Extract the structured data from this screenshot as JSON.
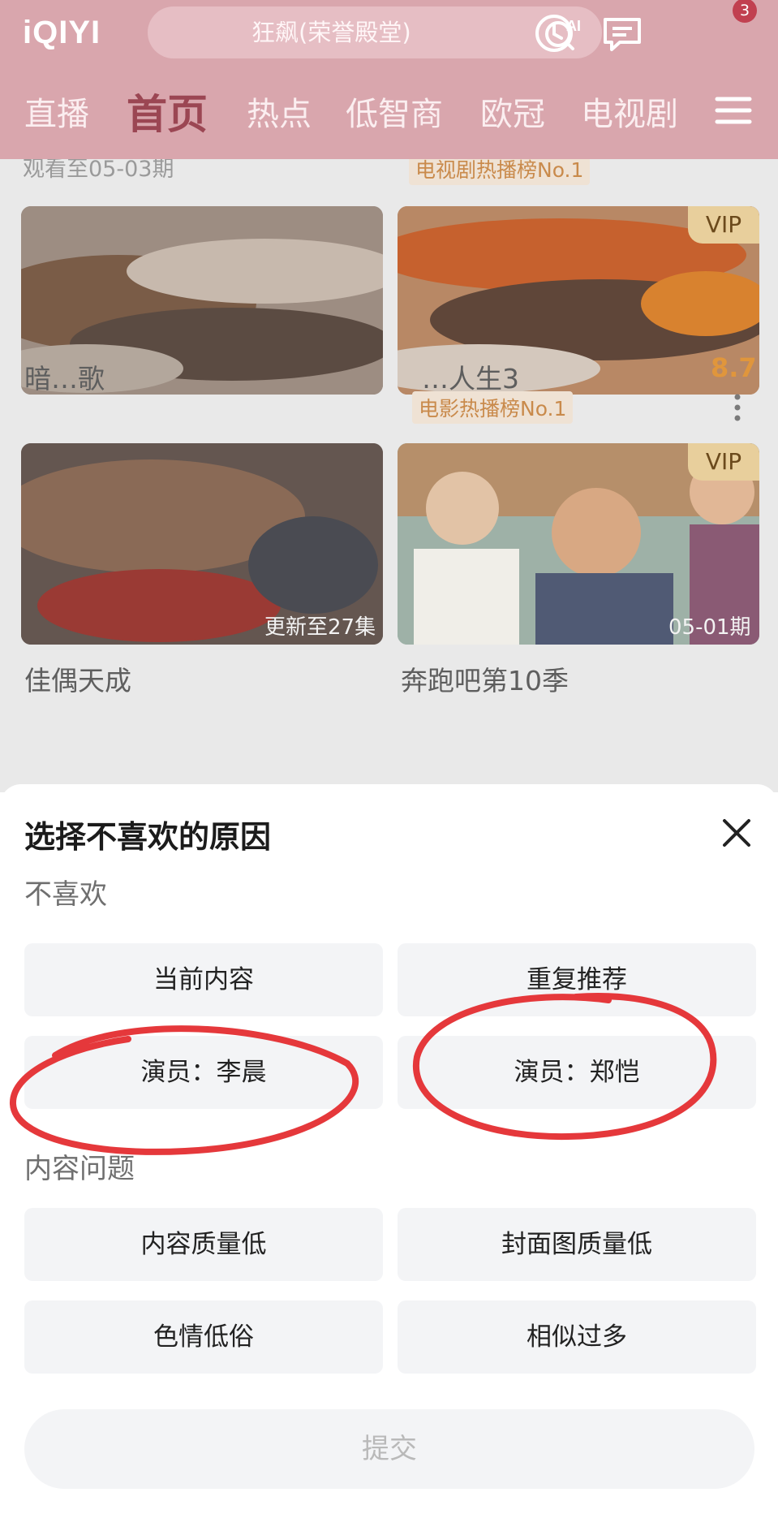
{
  "header": {
    "logo": "iQIYI",
    "search_text": "狂飙(荣誉殿堂)",
    "ai_label": "AI",
    "badge_count": "3",
    "tabs": [
      {
        "label": "直播"
      },
      {
        "label": "首页"
      },
      {
        "label": "热点"
      },
      {
        "label": "低智商"
      },
      {
        "label": "欧冠"
      },
      {
        "label": "电视剧"
      }
    ]
  },
  "feed": {
    "top_subline": "观看至05-03期",
    "top_rank": "电视剧热播榜No.1",
    "cards": [
      {
        "title": "暗…歌",
        "badge": "",
        "episode": ""
      },
      {
        "title": "…人生3",
        "badge": "VIP",
        "rank": "电影热播榜No.1",
        "score": "8.7"
      },
      {
        "title": "佳偶天成",
        "badge": "",
        "episode": "更新至27集"
      },
      {
        "title": "奔跑吧第10季",
        "badge": "VIP",
        "episode": "05-01期"
      }
    ]
  },
  "sheet": {
    "title": "选择不喜欢的原因",
    "section_dislike": "不喜欢",
    "dislike_options": [
      "当前内容",
      "重复推荐",
      "演员：李晨",
      "演员：郑恺"
    ],
    "section_content": "内容问题",
    "content_options": [
      "内容质量低",
      "封面图质量低",
      "色情低俗",
      "相似过多"
    ],
    "submit_label": "提交"
  },
  "colors": {
    "header_bg": "#d9a6ad",
    "annotation_red": "#e5383b",
    "option_bg": "#f3f4f6"
  }
}
